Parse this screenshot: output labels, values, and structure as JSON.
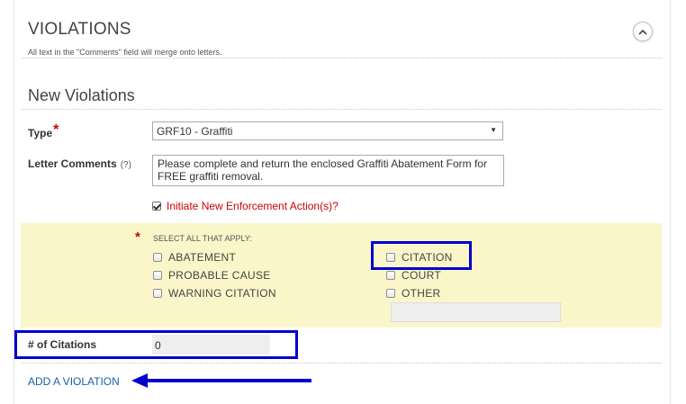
{
  "section": {
    "title": "VIOLATIONS",
    "hint": "All text in the \"Comments\" field will merge onto letters."
  },
  "collapse_icon": "chevron-up-icon",
  "new_violations": {
    "title": "New Violations",
    "type": {
      "label": "Type",
      "required_mark": "*",
      "selected": "GRF10 - Graffiti",
      "arrow": "▼"
    },
    "letter_comments": {
      "label": "Letter Comments",
      "help": "(?)",
      "value": "Please complete and return the enclosed Graffiti Abatement Form for FREE graffiti removal."
    },
    "initiate": {
      "label": "Initiate New Enforcement Action(s)?",
      "checked": true
    }
  },
  "apply": {
    "required_mark": "*",
    "hint": "SELECT ALL THAT APPLY:",
    "options_left": [
      "ABATEMENT",
      "PROBABLE CAUSE",
      "WARNING CITATION"
    ],
    "options_right": [
      "CITATION",
      "COURT",
      "OTHER"
    ]
  },
  "citations": {
    "label": "# of Citations",
    "value": "0"
  },
  "add_violation": "ADD A VIOLATION",
  "colors": {
    "highlight_panel": "#faf6c9",
    "annotation": "#0000cc",
    "required": "#cc0000",
    "link": "#1a5fa8"
  }
}
